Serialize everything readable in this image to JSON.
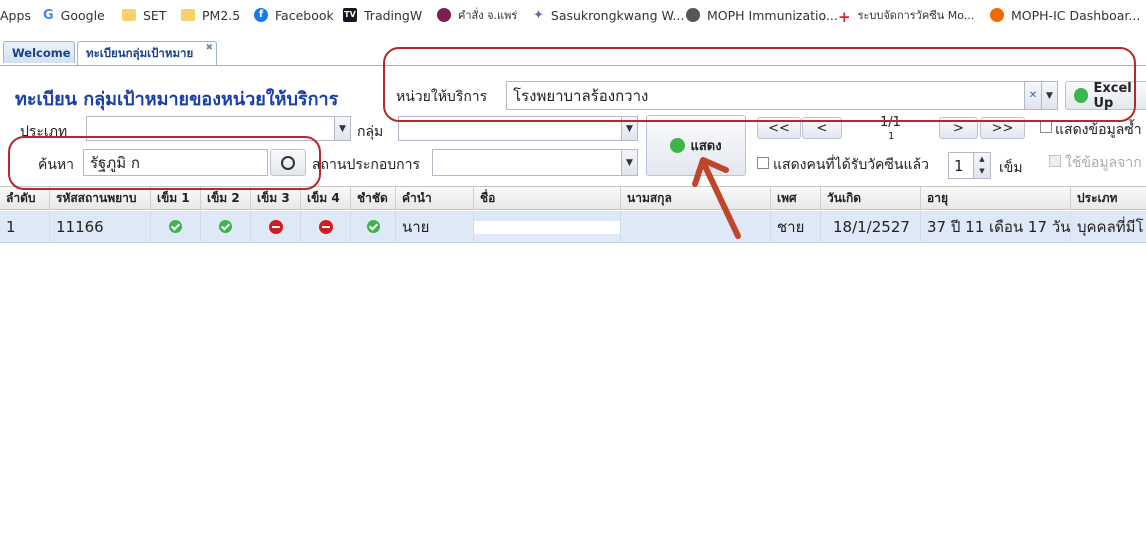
{
  "bookmarks": [
    {
      "label": "Apps",
      "icon": "apps-icon"
    },
    {
      "label": "Google",
      "icon": "google-icon"
    },
    {
      "label": "SET",
      "icon": "folder-icon"
    },
    {
      "label": "PM2.5",
      "icon": "folder-icon"
    },
    {
      "label": "Facebook",
      "icon": "facebook-icon"
    },
    {
      "label": "TradingW",
      "icon": "tradingview-icon"
    },
    {
      "label": "คำสั่ง จ.แพร่",
      "icon": "virus-icon"
    },
    {
      "label": "Sasukrongkwang W...",
      "icon": "caduceus-icon"
    },
    {
      "label": "MOPH Immunizatio...",
      "icon": "globe-icon"
    },
    {
      "label": "ระบบจัดการวัคซีน Mo...",
      "icon": "red-cross-icon"
    },
    {
      "label": "MOPH-IC Dashboar...",
      "icon": "grafana-icon"
    }
  ],
  "tabs": [
    {
      "label": "Welcome"
    },
    {
      "label": "ทะเบียนกลุ่มเป้าหมาย"
    }
  ],
  "page": {
    "title": "ทะเบียน กลุ่มเป้าหมายของหน่วยให้บริการ"
  },
  "filters": {
    "unit_label": "หน่วยให้บริการ",
    "unit_value": "โรงพยาบาลร้องกวาง",
    "excel_label": "Excel Up",
    "type_label": "ประเภท",
    "type_value": "",
    "group_label": "กลุ่ม",
    "group_value": "",
    "search_label": "ค้นหา",
    "search_value": "รัฐภูมิ ก",
    "workplace_label": "สถานประกอบการ",
    "workplace_value": "",
    "show_button": "แสดง",
    "pager": {
      "first": "<<",
      "prev": "<",
      "next": ">",
      "last": ">>",
      "page_text": "1/1",
      "page_sub": "1"
    },
    "show_detail_label": "แสดงข้อมูลซ้ำ",
    "show_vaccinated_label": "แสดงคนที่ได้รับวัคซีนแล้ว",
    "dose_value": "1",
    "dose_unit": "เข็ม",
    "use_data_label": "ใช้ข้อมูลจาก"
  },
  "grid": {
    "columns": [
      "ลำดับ",
      "รหัสสถานพยาบ",
      "เข็ม 1",
      "เข็ม 2",
      "เข็ม 3",
      "เข็ม 4",
      "ชำชัด",
      "คำนำ",
      "ชื่อ",
      "นามสกุล",
      "เพศ",
      "วันเกิด",
      "อายุ",
      "ประเภท"
    ],
    "rows": [
      {
        "no": "1",
        "hospcode": "11166",
        "dose1": "done",
        "dose2": "done",
        "dose3": "not-given",
        "dose4": "not-given",
        "extra": "done",
        "prefix": "นาย",
        "first_name": "",
        "last_name": "",
        "sex": "ชาย",
        "birthdate": "18/1/2527",
        "age": "37 ปี 11 เดือน 17 วัน",
        "category": "บุคคลที่มีโ"
      }
    ]
  },
  "colors": {
    "title": "#1a3fa8",
    "annotation": "#b22a2a",
    "ok": "#3cb54a",
    "no": "#d11d1d",
    "row_selected": "#dfe8f6"
  }
}
